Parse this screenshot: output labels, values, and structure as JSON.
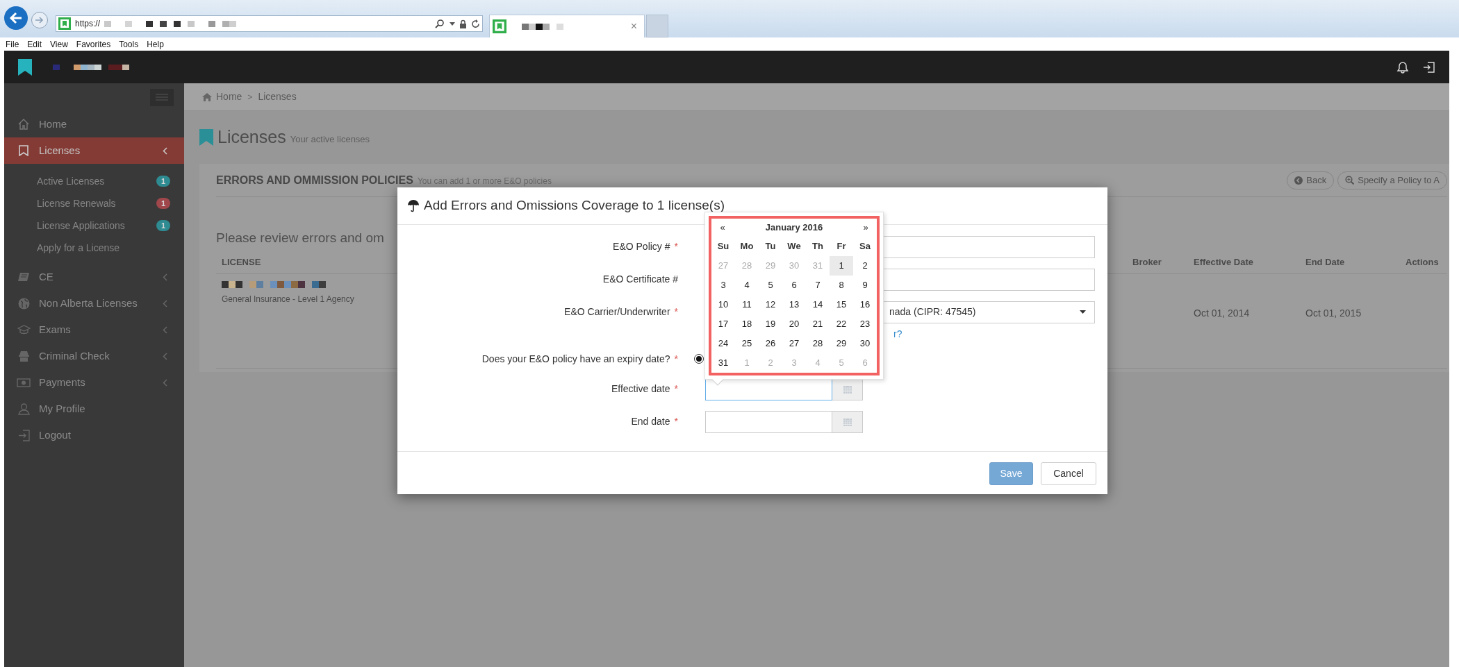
{
  "browser": {
    "address": "https://",
    "menu": [
      "File",
      "Edit",
      "View",
      "Favorites",
      "Tools",
      "Help"
    ],
    "tab_close": "×"
  },
  "sidebar": {
    "items": [
      {
        "label": "Home",
        "selected": false,
        "expandable": false
      },
      {
        "label": "Licenses",
        "selected": true,
        "expandable": true,
        "children": [
          {
            "label": "Active Licenses",
            "selected": false,
            "badge": "1",
            "color": "#2e8b91"
          },
          {
            "label": "License Renewals",
            "selected": false,
            "badge": "1",
            "color": "#a0474c"
          },
          {
            "label": "License Applications",
            "selected": false,
            "badge": "1",
            "color": "#2e8b91"
          },
          {
            "label": "Apply for a License",
            "selected": false
          }
        ]
      },
      {
        "label": "CE",
        "selected": false,
        "expandable": true
      },
      {
        "label": "Non Alberta Licenses",
        "selected": false,
        "expandable": true
      },
      {
        "label": "Exams",
        "selected": false,
        "expandable": true
      },
      {
        "label": "Criminal Check",
        "selected": false,
        "expandable": true
      },
      {
        "label": "Payments",
        "selected": false,
        "expandable": true
      },
      {
        "label": "My Profile",
        "selected": false,
        "expandable": false
      },
      {
        "label": "Logout",
        "selected": false,
        "expandable": false
      }
    ]
  },
  "breadcrumb": {
    "items": [
      "Home",
      "Licenses"
    ],
    "separator": ">"
  },
  "page": {
    "title": "Licenses",
    "subtitle": "Your active licenses"
  },
  "panel": {
    "title": "ERRORS AND OMMISSION POLICIES",
    "subtitle": "You can add 1 or more E&O policies",
    "buttons": [
      "Back",
      "Specify a Policy to A"
    ],
    "intro": "Please review errors and om",
    "table": {
      "columns": [
        "LICENSE",
        "Broker",
        "Effective Date",
        "End Date",
        "Actions"
      ],
      "rows": [
        {
          "license_type": "General Insurance - Level 1 Agency",
          "effective_date": "Oct 01, 2014",
          "end_date": "Oct 01, 2015"
        }
      ]
    }
  },
  "modal": {
    "title": "Add Errors and Omissions Coverage to 1 license(s)",
    "required_mark": "*",
    "fields": [
      {
        "kind": "text",
        "label": "E&O Policy #",
        "required": true
      },
      {
        "kind": "text",
        "label": "E&O Certificate #",
        "required": false
      },
      {
        "kind": "select",
        "label": "E&O Carrier/Underwriter",
        "required": true,
        "value": "nada (CIPR: 47545)",
        "help_link": "r?"
      },
      {
        "kind": "radio",
        "label": "Does your E&O policy have an expiry date?",
        "required": true,
        "checked": true
      },
      {
        "kind": "date",
        "label": "Effective date",
        "required": true,
        "focused": true
      },
      {
        "kind": "date",
        "label": "End date",
        "required": true,
        "focused": false
      }
    ],
    "buttons": [
      {
        "label": "Save",
        "primary": true
      },
      {
        "label": "Cancel",
        "primary": false
      }
    ]
  },
  "datepicker": {
    "prev": "«",
    "month": "January 2016",
    "next": "»",
    "highlight_frame": true,
    "weekdays": [
      "Su",
      "Mo",
      "Tu",
      "We",
      "Th",
      "Fr",
      "Sa"
    ],
    "weeks": [
      [
        {
          "d": "27",
          "muted": true,
          "selected": false
        },
        {
          "d": "28",
          "muted": true,
          "selected": false
        },
        {
          "d": "29",
          "muted": true,
          "selected": false
        },
        {
          "d": "30",
          "muted": true,
          "selected": false
        },
        {
          "d": "31",
          "muted": true,
          "selected": false
        },
        {
          "d": "1",
          "muted": false,
          "selected": true
        },
        {
          "d": "2",
          "muted": false,
          "selected": false
        }
      ],
      [
        {
          "d": "3",
          "muted": false,
          "selected": false
        },
        {
          "d": "4",
          "muted": false,
          "selected": false
        },
        {
          "d": "5",
          "muted": false,
          "selected": false
        },
        {
          "d": "6",
          "muted": false,
          "selected": false
        },
        {
          "d": "7",
          "muted": false,
          "selected": false
        },
        {
          "d": "8",
          "muted": false,
          "selected": false
        },
        {
          "d": "9",
          "muted": false,
          "selected": false
        }
      ],
      [
        {
          "d": "10",
          "muted": false,
          "selected": false
        },
        {
          "d": "11",
          "muted": false,
          "selected": false
        },
        {
          "d": "12",
          "muted": false,
          "selected": false
        },
        {
          "d": "13",
          "muted": false,
          "selected": false
        },
        {
          "d": "14",
          "muted": false,
          "selected": false
        },
        {
          "d": "15",
          "muted": false,
          "selected": false
        },
        {
          "d": "16",
          "muted": false,
          "selected": false
        }
      ],
      [
        {
          "d": "17",
          "muted": false,
          "selected": false
        },
        {
          "d": "18",
          "muted": false,
          "selected": false
        },
        {
          "d": "19",
          "muted": false,
          "selected": false
        },
        {
          "d": "20",
          "muted": false,
          "selected": false
        },
        {
          "d": "21",
          "muted": false,
          "selected": false
        },
        {
          "d": "22",
          "muted": false,
          "selected": false
        },
        {
          "d": "23",
          "muted": false,
          "selected": false
        }
      ],
      [
        {
          "d": "24",
          "muted": false,
          "selected": false
        },
        {
          "d": "25",
          "muted": false,
          "selected": false
        },
        {
          "d": "26",
          "muted": false,
          "selected": false
        },
        {
          "d": "27",
          "muted": false,
          "selected": false
        },
        {
          "d": "28",
          "muted": false,
          "selected": false
        },
        {
          "d": "29",
          "muted": false,
          "selected": false
        },
        {
          "d": "30",
          "muted": false,
          "selected": false
        }
      ],
      [
        {
          "d": "31",
          "muted": false,
          "selected": false
        },
        {
          "d": "1",
          "muted": true,
          "selected": false
        },
        {
          "d": "2",
          "muted": true,
          "selected": false
        },
        {
          "d": "3",
          "muted": true,
          "selected": false
        },
        {
          "d": "4",
          "muted": true,
          "selected": false
        },
        {
          "d": "5",
          "muted": true,
          "selected": false
        },
        {
          "d": "6",
          "muted": true,
          "selected": false
        }
      ]
    ]
  }
}
